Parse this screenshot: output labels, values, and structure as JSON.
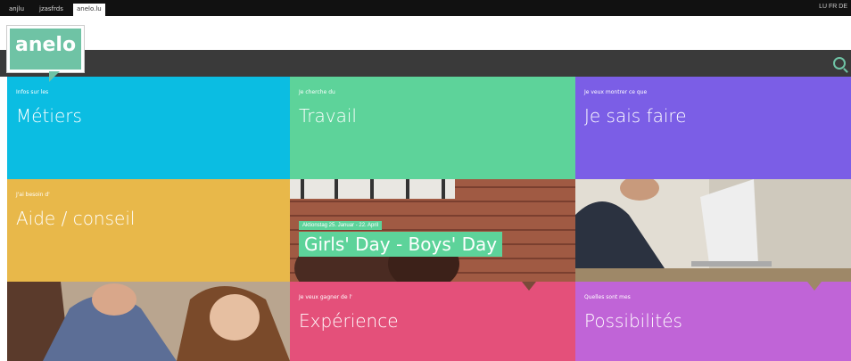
{
  "topbar": {
    "tabs": [
      "anjlu",
      "jzasfrds",
      "anelo.lu"
    ],
    "right_text": "LU FR DE"
  },
  "logo": {
    "text": "anelo"
  },
  "tiles": {
    "metiers": {
      "small": "Infos sur les",
      "big": "Métiers"
    },
    "travail": {
      "small": "Je cherche du",
      "big": "Travail"
    },
    "je_sais_faire": {
      "small": "Je veux montrer ce que",
      "big": "Je sais faire"
    },
    "aide": {
      "small": "J'ai besoin d'",
      "big": "Aide / conseil"
    },
    "girls_day": {
      "date": "Aktionstag 25. Januar - 22. April",
      "title": "Girls' Day - Boys' Day"
    },
    "experience": {
      "small": "Je veux gagner de l'",
      "big": "Expérience"
    },
    "possibilites": {
      "small": "Quelles sont mes",
      "big": "Possibilités"
    }
  },
  "colors": {
    "cyan": "#0bbde2",
    "green": "#5dd39a",
    "purple": "#7b5ee6",
    "yellow": "#e8b84a",
    "pink": "#e4507a",
    "violet": "#c064d7",
    "nav": "#3a3a3a"
  }
}
